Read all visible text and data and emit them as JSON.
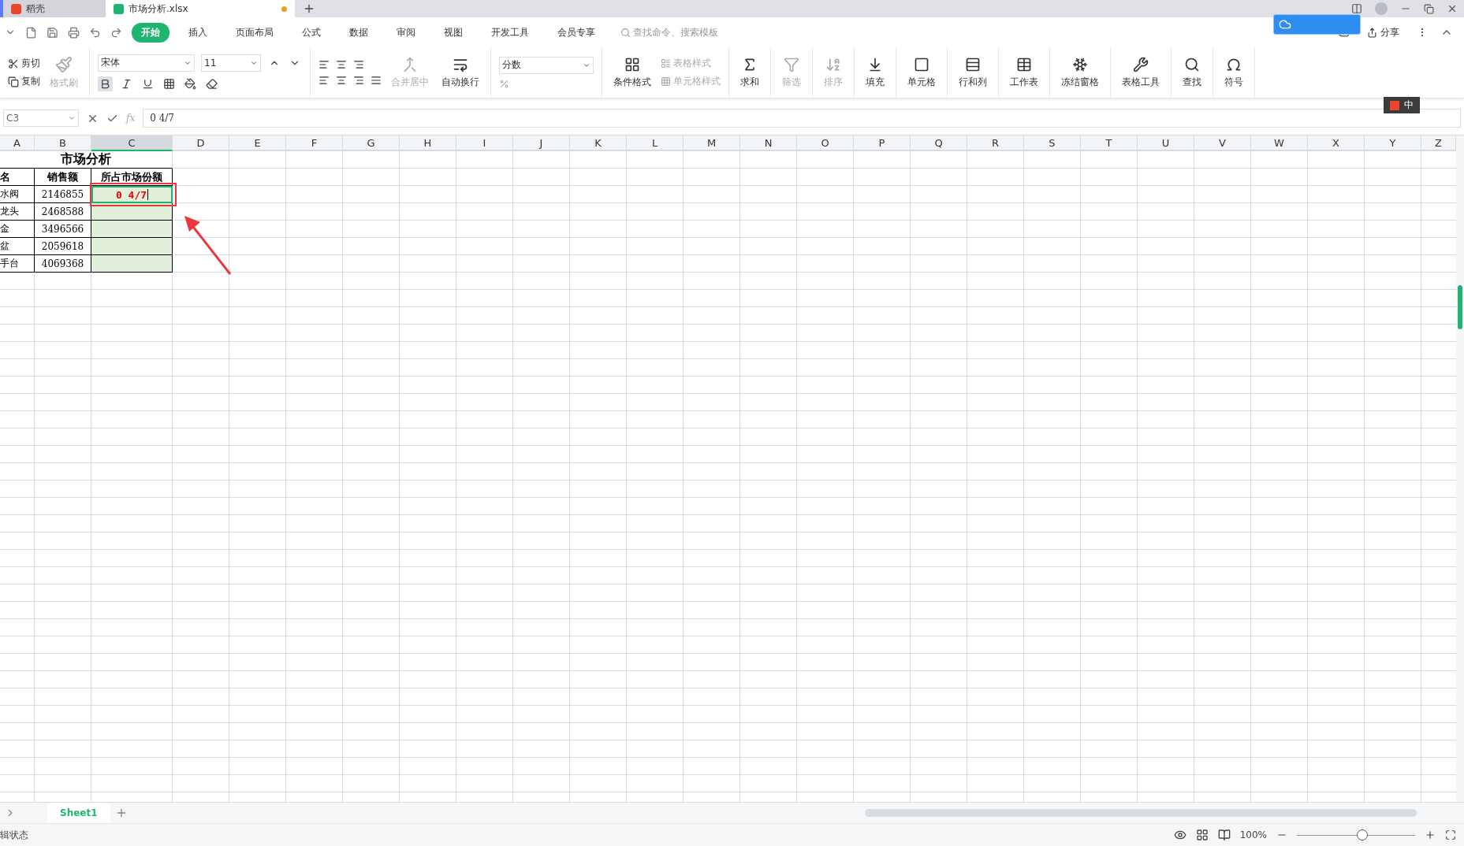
{
  "tabs": [
    {
      "label": "稻壳",
      "kind": "docer",
      "selected": false,
      "unsaved": false
    },
    {
      "label": "市场分析.xlsx",
      "kind": "sheet",
      "selected": true,
      "unsaved": true
    }
  ],
  "menu": [
    {
      "label": "开始",
      "selected": true
    },
    {
      "label": "插入",
      "selected": false
    },
    {
      "label": "页面布局",
      "selected": false
    },
    {
      "label": "公式",
      "selected": false
    },
    {
      "label": "数据",
      "selected": false
    },
    {
      "label": "审阅",
      "selected": false
    },
    {
      "label": "视图",
      "selected": false
    },
    {
      "label": "开发工具",
      "selected": false
    },
    {
      "label": "会员专享",
      "selected": false
    }
  ],
  "search": {
    "placeholder": "查找命令、搜索模板"
  },
  "share": "分享",
  "clipboard": [
    {
      "label": "剪切",
      "kind": "cut",
      "disabled": false
    },
    {
      "label": "复制",
      "kind": "copy",
      "disabled": false
    },
    {
      "label": "格式刷",
      "kind": "brush",
      "disabled": true
    }
  ],
  "font": {
    "name": "宋体",
    "size": "11",
    "bold": true
  },
  "align": [
    {
      "label": "合并居中",
      "kind": "merge",
      "disabled": true
    },
    {
      "label": "自动换行",
      "kind": "wrap",
      "disabled": false
    }
  ],
  "number_format": "分数",
  "function_label": "fx",
  "styles": [
    {
      "label": "条件格式",
      "kind": "conditional",
      "disabled": false
    },
    {
      "label": "表格样式",
      "kind": "table",
      "disabled": true
    },
    {
      "label": "单元格样式",
      "kind": "cellstyle",
      "disabled": true
    }
  ],
  "tools": [
    {
      "label": "求和",
      "kind": "sum",
      "disabled": false
    },
    {
      "label": "筛选",
      "kind": "filter",
      "disabled": true
    },
    {
      "label": "排序",
      "kind": "sort",
      "disabled": true
    },
    {
      "label": "填充",
      "kind": "fill",
      "disabled": false
    },
    {
      "label": "单元格",
      "kind": "cell",
      "disabled": false
    },
    {
      "label": "行和列",
      "kind": "rowcol",
      "disabled": false
    },
    {
      "label": "工作表",
      "kind": "sheet",
      "disabled": false
    },
    {
      "label": "冻结窗格",
      "kind": "freeze",
      "disabled": false
    },
    {
      "label": "表格工具",
      "kind": "tabletool",
      "disabled": false
    },
    {
      "label": "查找",
      "kind": "find",
      "disabled": false
    },
    {
      "label": "符号",
      "kind": "symbol",
      "disabled": false
    }
  ],
  "ime": {
    "mode": "中"
  },
  "formula_bar": {
    "cell": "C3",
    "content": "0 4/7"
  },
  "columns": [
    {
      "label": "A",
      "selected": false
    },
    {
      "label": "B",
      "selected": false
    },
    {
      "label": "C",
      "selected": true
    },
    {
      "label": "D",
      "selected": false
    },
    {
      "label": "E",
      "selected": false
    },
    {
      "label": "F",
      "selected": false
    },
    {
      "label": "G",
      "selected": false
    },
    {
      "label": "H",
      "selected": false
    },
    {
      "label": "I",
      "selected": false
    },
    {
      "label": "J",
      "selected": false
    },
    {
      "label": "K",
      "selected": false
    },
    {
      "label": "L",
      "selected": false
    },
    {
      "label": "M",
      "selected": false
    },
    {
      "label": "N",
      "selected": false
    },
    {
      "label": "O",
      "selected": false
    },
    {
      "label": "P",
      "selected": false
    },
    {
      "label": "Q",
      "selected": false
    },
    {
      "label": "R",
      "selected": false
    },
    {
      "label": "S",
      "selected": false
    },
    {
      "label": "T",
      "selected": false
    },
    {
      "label": "U",
      "selected": false
    },
    {
      "label": "V",
      "selected": false
    },
    {
      "label": "W",
      "selected": false
    },
    {
      "label": "X",
      "selected": false
    },
    {
      "label": "Y",
      "selected": false
    },
    {
      "label": "Z",
      "selected": false
    }
  ],
  "rows": [
    {
      "kind": "title",
      "cells": [
        {
          "text": "市场分析",
          "selected": false
        }
      ]
    },
    {
      "kind": "header",
      "cells": [
        {
          "text": "名",
          "selected": false
        },
        {
          "text": "销售额",
          "selected": false
        },
        {
          "text": "所占市场份额",
          "selected": false
        }
      ]
    },
    {
      "kind": "data",
      "cells": [
        {
          "text": "水阀",
          "selected": false
        },
        {
          "text": "2146855",
          "selected": false
        },
        {
          "text": "0 4/7",
          "selected": true
        }
      ]
    },
    {
      "kind": "data",
      "cells": [
        {
          "text": "龙头",
          "selected": false
        },
        {
          "text": "2468588",
          "selected": false
        }
      ]
    },
    {
      "kind": "data",
      "cells": [
        {
          "text": "金",
          "selected": false
        },
        {
          "text": "3496566",
          "selected": false
        }
      ]
    },
    {
      "kind": "data",
      "cells": [
        {
          "text": "盆",
          "selected": false
        },
        {
          "text": "2059618",
          "selected": false
        }
      ]
    },
    {
      "kind": "data",
      "cells": [
        {
          "text": "手台",
          "selected": false
        },
        {
          "text": "4069368",
          "selected": false
        }
      ]
    }
  ],
  "sheets": [
    {
      "label": "Sheet1",
      "selected": true
    }
  ],
  "status": "辑状态",
  "zoom": {
    "label": "100%",
    "level": 0.55
  }
}
